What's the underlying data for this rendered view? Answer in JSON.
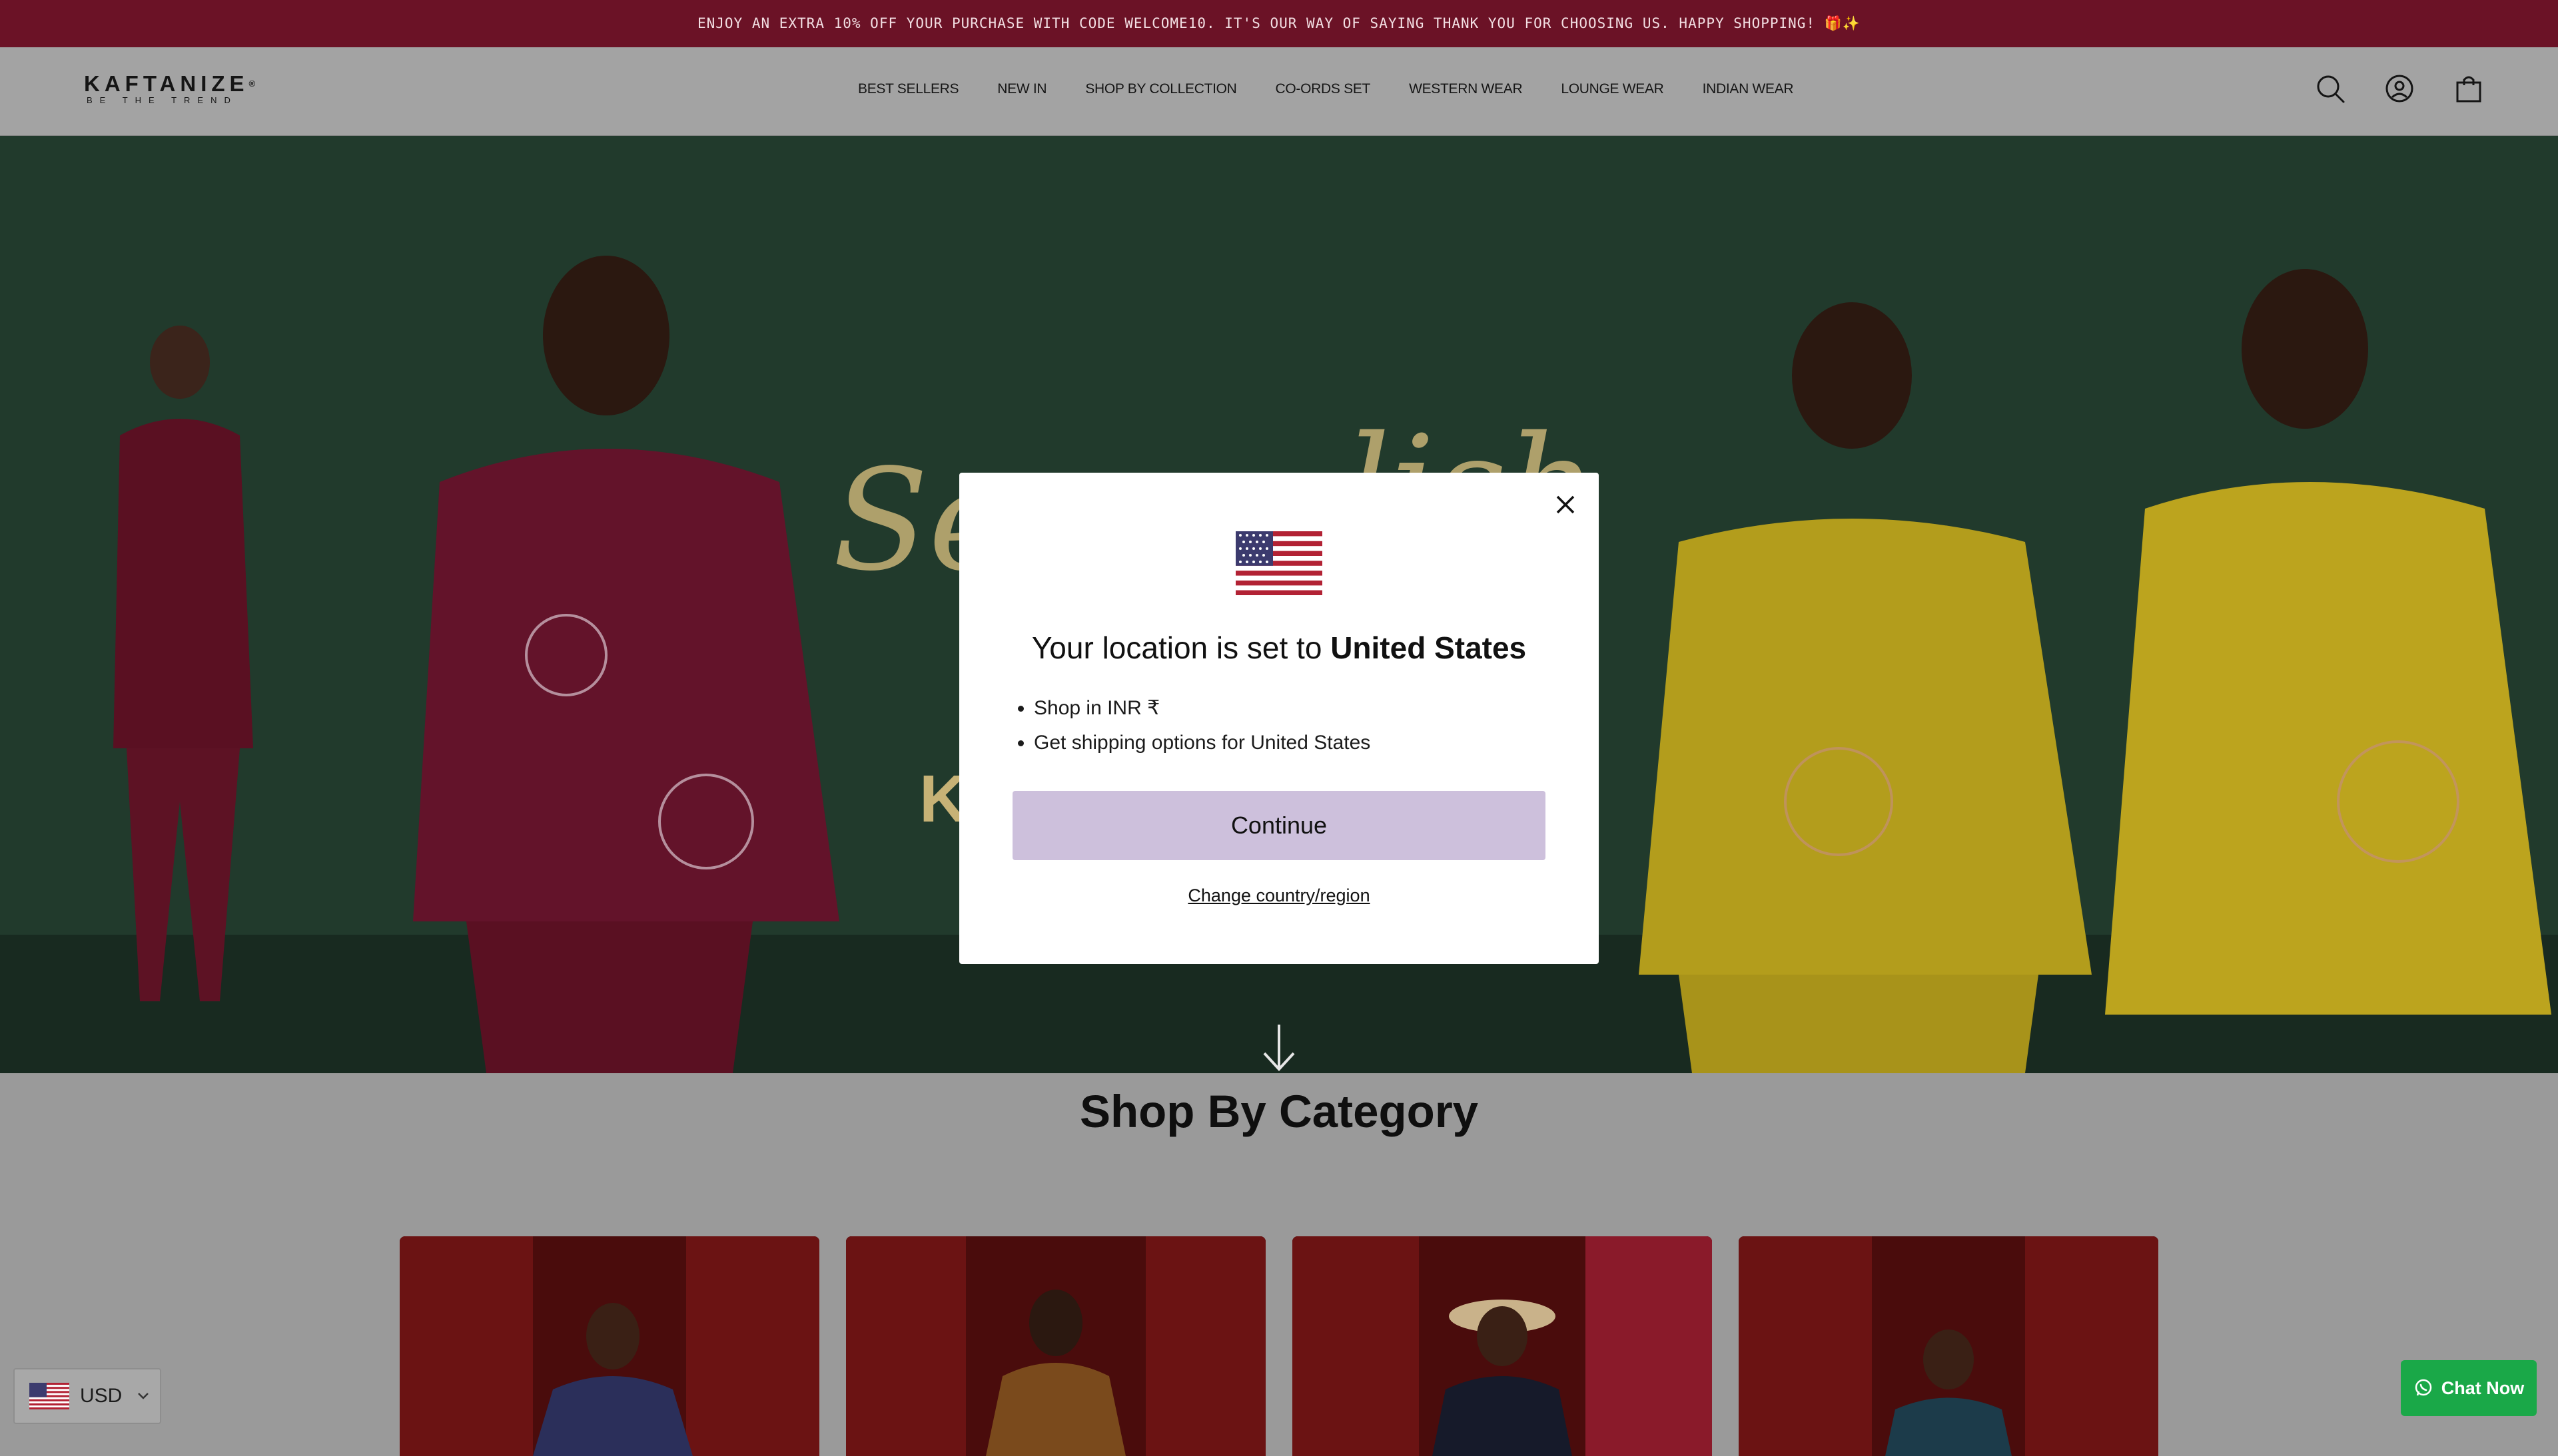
{
  "announcement": {
    "text": "ENJOY AN EXTRA 10% OFF YOUR PURCHASE WITH CODE WELCOME10. IT'S OUR WAY OF SAYING THANK YOU FOR CHOOSING US. HAPPY SHOPPING! 🎁✨"
  },
  "header": {
    "logo_main": "KAFTANIZE",
    "logo_mark": "®",
    "logo_tagline": "BE THE TREND",
    "nav": [
      {
        "label": "BEST SELLERS"
      },
      {
        "label": "NEW IN"
      },
      {
        "label": "SHOP BY COLLECTION"
      },
      {
        "label": "CO-ORDS SET"
      },
      {
        "label": "WESTERN WEAR"
      },
      {
        "label": "LOUNGE WEAR"
      },
      {
        "label": "INDIAN WEAR"
      }
    ],
    "icons": [
      "search-icon",
      "account-icon",
      "cart-icon"
    ]
  },
  "hero": {
    "overlay_text_visible": "K"
  },
  "modal": {
    "heading_prefix": "Your location is set to ",
    "heading_country": "United States",
    "bullets": [
      "Shop in INR ₹",
      "Get shipping options for United States"
    ],
    "continue_label": "Continue",
    "change_label": "Change country/region",
    "flag": "us-flag-icon"
  },
  "category_section": {
    "title": "Shop By Category",
    "cards": [
      {
        "id": 1
      },
      {
        "id": 2
      },
      {
        "id": 3
      },
      {
        "id": 4
      }
    ]
  },
  "currency": {
    "code": "USD",
    "flag": "us-flag-icon"
  },
  "chat": {
    "label": "Chat Now",
    "icon": "whatsapp-icon"
  },
  "colors": {
    "announcement_bg": "#6b1226",
    "continue_bg": "#cdc0dc",
    "chat_bg": "#1aa848"
  }
}
